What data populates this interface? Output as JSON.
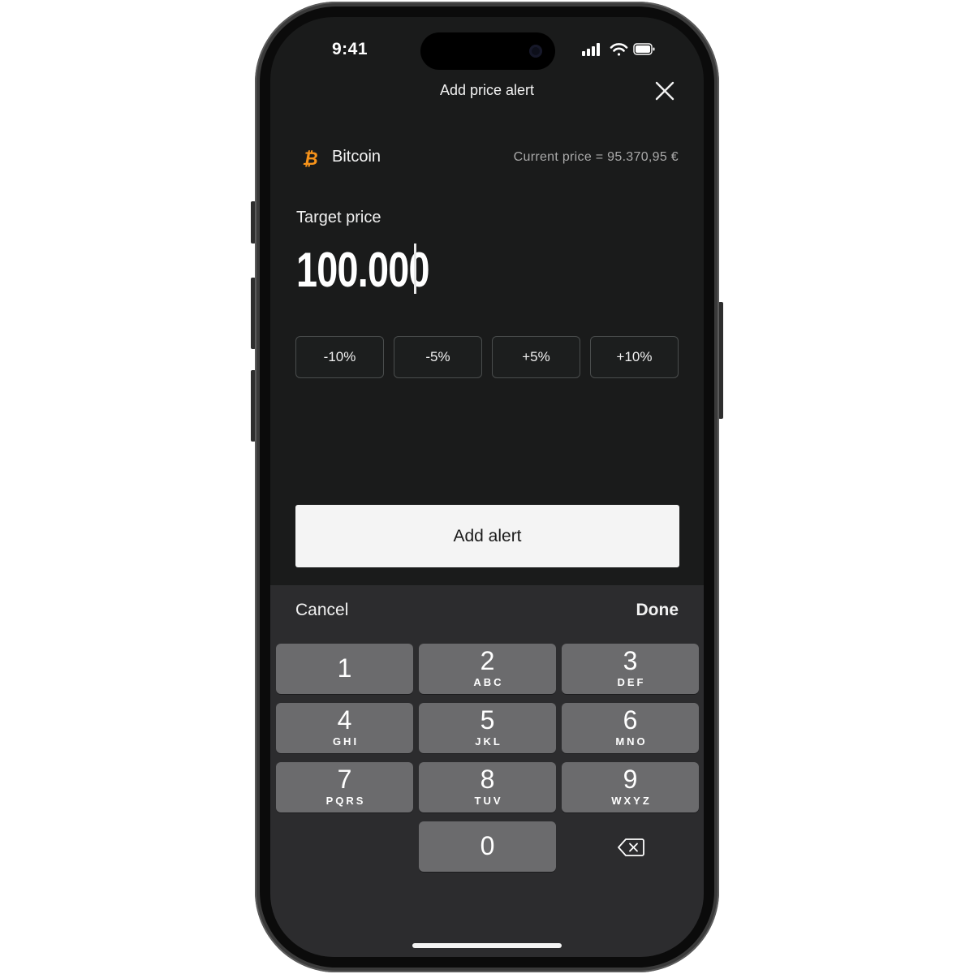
{
  "status_bar": {
    "time": "9:41",
    "icons": [
      "signal-icon",
      "wifi-icon",
      "battery-icon"
    ]
  },
  "header": {
    "title": "Add price alert",
    "close_icon": "close-icon"
  },
  "asset": {
    "name": "Bitcoin",
    "icon": "bitcoin-icon",
    "icon_color": "#F7931A",
    "current_price": "Current price = 95.370,95 €"
  },
  "target": {
    "label": "Target price",
    "value": "100.000"
  },
  "adjustments": [
    "-10%",
    "-5%",
    "+5%",
    "+10%"
  ],
  "primary_button": {
    "label": "Add alert"
  },
  "keyboard_toolbar": {
    "cancel": "Cancel",
    "done": "Done"
  },
  "keypad": [
    {
      "digit": "1",
      "letters": ""
    },
    {
      "digit": "2",
      "letters": "ABC"
    },
    {
      "digit": "3",
      "letters": "DEF"
    },
    {
      "digit": "4",
      "letters": "GHI"
    },
    {
      "digit": "5",
      "letters": "JKL"
    },
    {
      "digit": "6",
      "letters": "MNO"
    },
    {
      "digit": "7",
      "letters": "PQRS"
    },
    {
      "digit": "8",
      "letters": "TUV"
    },
    {
      "digit": "9",
      "letters": "WXYZ"
    },
    {
      "digit": "0",
      "letters": ""
    }
  ],
  "colors": {
    "screen_bg": "#1A1B1B",
    "keyboard_bg": "#2C2C2E",
    "key_bg": "#6B6B6D",
    "button_bg": "#F4F4F4"
  }
}
